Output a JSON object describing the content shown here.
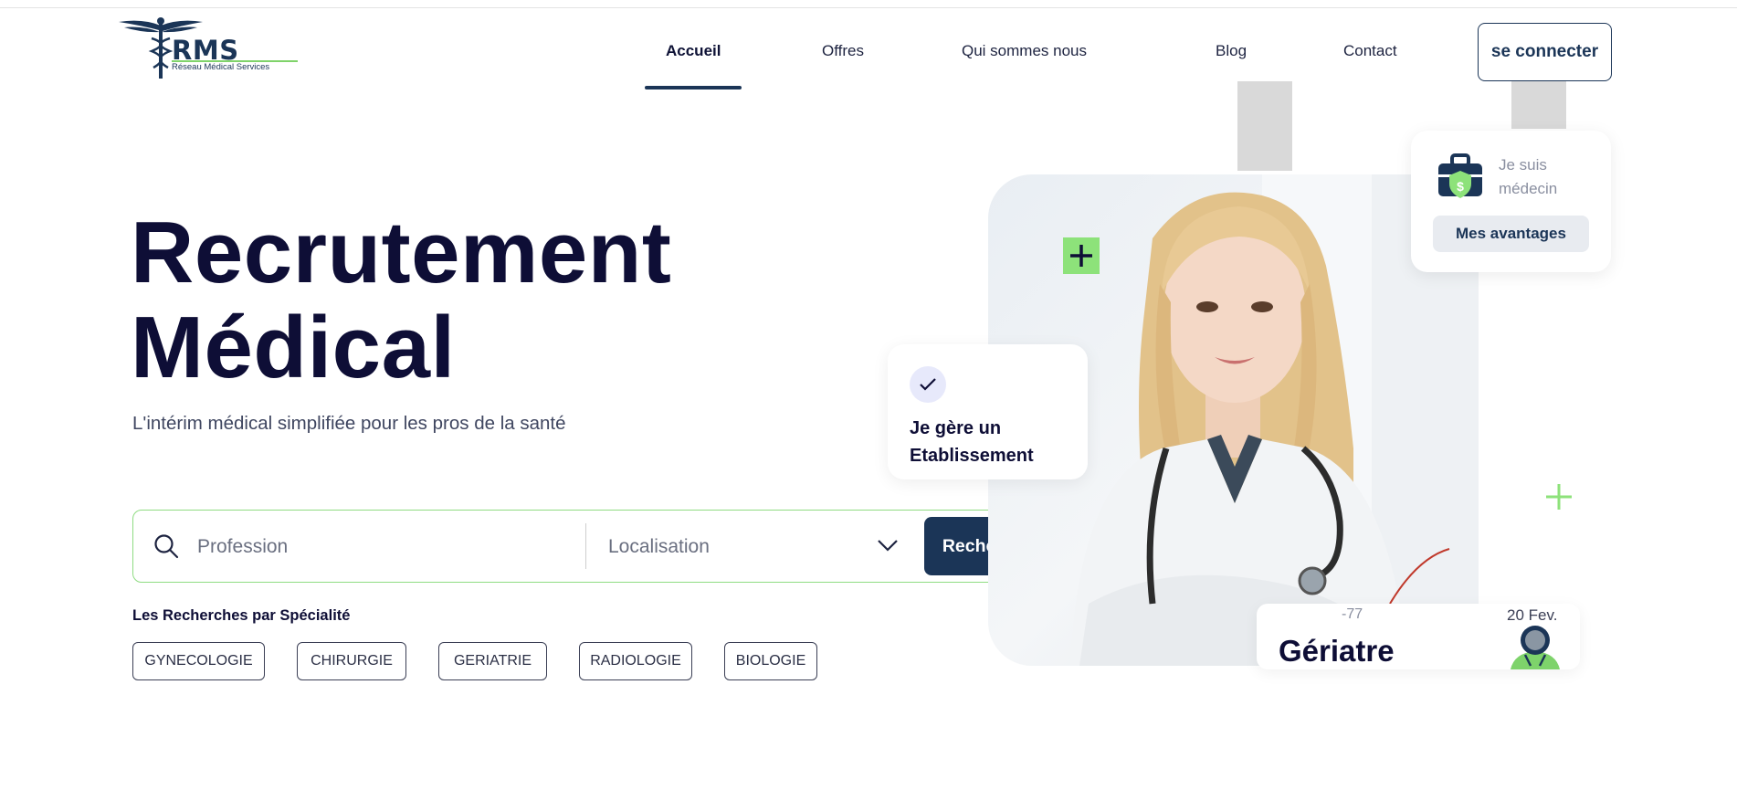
{
  "logo": {
    "brand": "RMS",
    "tagline": "Réseau Médical Services",
    "icon": "caduceus-icon"
  },
  "nav": {
    "items": [
      {
        "label": "Accueil",
        "active": true
      },
      {
        "label": "Offres",
        "active": false
      },
      {
        "label": "Qui sommes nous",
        "active": false
      },
      {
        "label": "Blog",
        "active": false
      },
      {
        "label": "Contact",
        "active": false
      }
    ],
    "login_label": "se connecter"
  },
  "hero": {
    "title_line1": "Recrutement",
    "title_line2": "Médical",
    "subtitle": "L'intérim médical simplifiée pour les pros de la santé"
  },
  "search": {
    "profession_placeholder": "Profession",
    "location_label": "Localisation",
    "button_label": "Rechercher"
  },
  "specialties": {
    "title": "Les Recherches par Spécialité",
    "items": [
      "GYNECOLOGIE",
      "CHIRURGIE",
      "GERIATRIE",
      "RADIOLOGIE",
      "BIOLOGIE"
    ]
  },
  "cards": {
    "etablissement": {
      "line1": "Je gère un",
      "line2": "Etablissement"
    },
    "medecin": {
      "line1": "Je suis",
      "line2": "médecin",
      "button_label": "Mes avantages"
    },
    "job": {
      "code": "-77",
      "date": "20 Fev.",
      "title": "Gériatre"
    }
  },
  "colors": {
    "primary": "#1b3557",
    "accent_green": "#8de27a",
    "title_dark": "#0e0e36"
  }
}
